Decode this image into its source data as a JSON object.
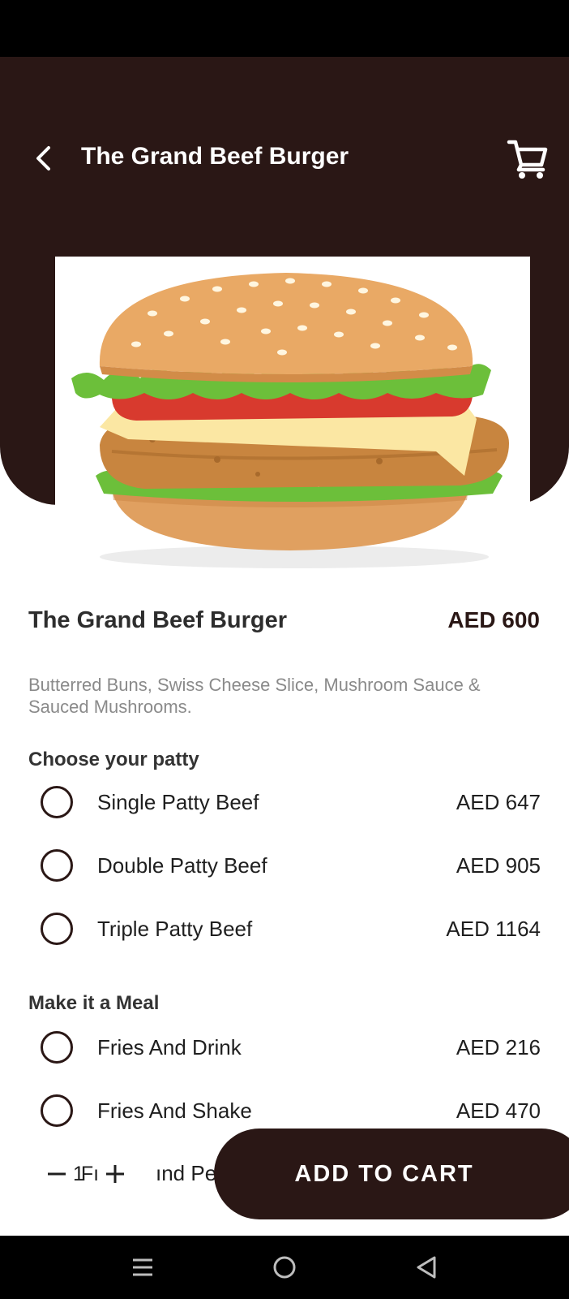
{
  "header": {
    "title": "The Grand Beef Burger",
    "back_icon": "chevron-left-icon",
    "cart_icon": "shopping-cart-icon"
  },
  "item": {
    "name": "The Grand Beef Burger",
    "price": "AED 600",
    "description": "Butterred Buns, Swiss Cheese Slice, Mushroom Sauce & Sauced Mushrooms."
  },
  "patty": {
    "title": "Choose your patty",
    "options": [
      {
        "label": "Single Patty Beef",
        "price": "AED 647"
      },
      {
        "label": "Double Patty Beef",
        "price": "AED 905"
      },
      {
        "label": "Triple Patty Beef",
        "price": "AED 1164"
      }
    ]
  },
  "meal": {
    "title": "Make it a Meal",
    "options": [
      {
        "label": "Fries And Drink",
        "price": "AED 216"
      },
      {
        "label": "Fries And Shake",
        "price": "AED 470"
      }
    ],
    "partial_label": "ınd Pe"
  },
  "stepper": {
    "quantity": "1",
    "quantity_overlap": "Fı"
  },
  "cta": {
    "label": "ADD TO CART"
  },
  "colors": {
    "brand_dark": "#2a1715",
    "background": "#ffffff",
    "description_text": "#8a8a8a"
  },
  "system_nav": {
    "icons": [
      "menu-icon",
      "home-circle-icon",
      "back-triangle-icon"
    ]
  }
}
